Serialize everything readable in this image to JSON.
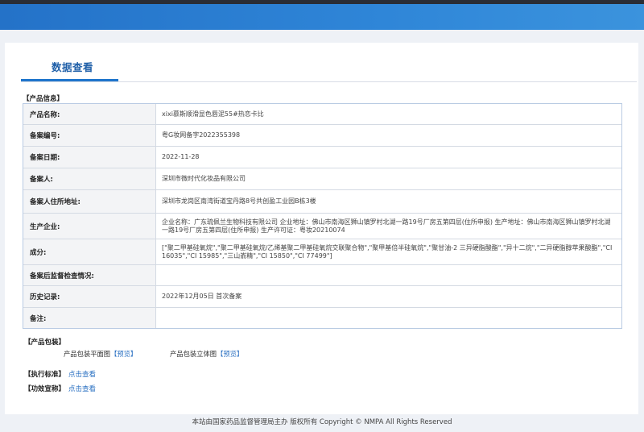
{
  "header": {
    "tab_title": "数据查看"
  },
  "product_info": {
    "section_label": "【产品信息】",
    "rows": [
      {
        "label": "产品名称:",
        "value": "xixi慕斯顺滑显色唇泥55#热恋卡比"
      },
      {
        "label": "备案编号:",
        "value": "粤G妆网备字2022355398"
      },
      {
        "label": "备案日期:",
        "value": "2022-11-28"
      },
      {
        "label": "备案人:",
        "value": "深圳市微时代化妆品有限公司"
      },
      {
        "label": "备案人住所地址:",
        "value": "深圳市龙岗区南湾街道宝丹路8号共创盈工业园B栋3楼"
      },
      {
        "label": "生产企业:",
        "value": "企业名称：广东琉佩兰生物科技有限公司 企业地址：佛山市南海区狮山镇罗村北湖一路19号厂房五第四层(住所申报) 生产地址：佛山市南海区狮山镇罗村北湖一路19号厂房五第四层(住所申报) 生产许可证：粤妆20210074"
      },
      {
        "label": "成分:",
        "value": "[\"聚二甲基硅氧烷\",\"聚二甲基硅氧烷/乙烯基聚二甲基硅氧烷交联聚合物\",\"聚甲基倍半硅氧烷\",\"聚甘油-2 三异硬脂酸酯\",\"异十二烷\",\"二异硬脂醇苹果酸酯\",\"CI 16035\",\"CI 15985\",\"三山嵛精\",\"CI 15850\",\"CI 77499\"]"
      },
      {
        "label": "备案后监督检查情况:",
        "value": ""
      },
      {
        "label": "历史记录:",
        "value": "2022年12月05日 首次备案"
      },
      {
        "label": "备注:",
        "value": ""
      }
    ]
  },
  "packaging": {
    "section_label": "【产品包装】",
    "flat_label": "产品包装平面图",
    "flat_link": "【预览】",
    "solid_label": "产品包装立体图",
    "solid_link": "【预览】"
  },
  "standard": {
    "label": "【执行标准】",
    "link": "点击查看"
  },
  "efficacy": {
    "label": "【功效宣称】",
    "link": "点击查看"
  },
  "footer": {
    "text": "本站由国家药品监督管理局主办 版权所有 Copyright © NMPA  All Rights Reserved"
  }
}
